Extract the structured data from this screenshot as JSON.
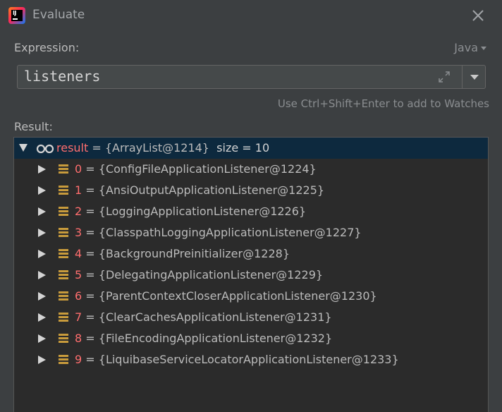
{
  "window": {
    "title": "Evaluate",
    "close_icon": "close-icon"
  },
  "expression": {
    "label": "Expression:",
    "value": "listeners",
    "language": "Java",
    "hint": "Use Ctrl+Shift+Enter to add to Watches"
  },
  "result": {
    "label": "Result:",
    "root": {
      "name": "result",
      "eq": " = ",
      "value": "{ArrayList@1214}",
      "extra": "size = 10"
    },
    "items": [
      {
        "name": "0",
        "eq": " = ",
        "value": "{ConfigFileApplicationListener@1224}"
      },
      {
        "name": "1",
        "eq": " = ",
        "value": "{AnsiOutputApplicationListener@1225}"
      },
      {
        "name": "2",
        "eq": " = ",
        "value": "{LoggingApplicationListener@1226}"
      },
      {
        "name": "3",
        "eq": " = ",
        "value": "{ClasspathLoggingApplicationListener@1227}"
      },
      {
        "name": "4",
        "eq": " = ",
        "value": "{BackgroundPreinitializer@1228}"
      },
      {
        "name": "5",
        "eq": " = ",
        "value": "{DelegatingApplicationListener@1229}"
      },
      {
        "name": "6",
        "eq": " = ",
        "value": "{ParentContextCloserApplicationListener@1230}"
      },
      {
        "name": "7",
        "eq": " = ",
        "value": "{ClearCachesApplicationListener@1231}"
      },
      {
        "name": "8",
        "eq": " = ",
        "value": "{FileEncodingApplicationListener@1232}"
      },
      {
        "name": "9",
        "eq": " = ",
        "value": "{LiquibaseServiceLocatorApplicationListener@1233}"
      }
    ]
  },
  "colors": {
    "background": "#3c3f41",
    "tree_background": "#2b2b2b",
    "selection": "#0d293e",
    "variable_name": "#ff6e6e",
    "field_icon": "#c89b3c"
  }
}
